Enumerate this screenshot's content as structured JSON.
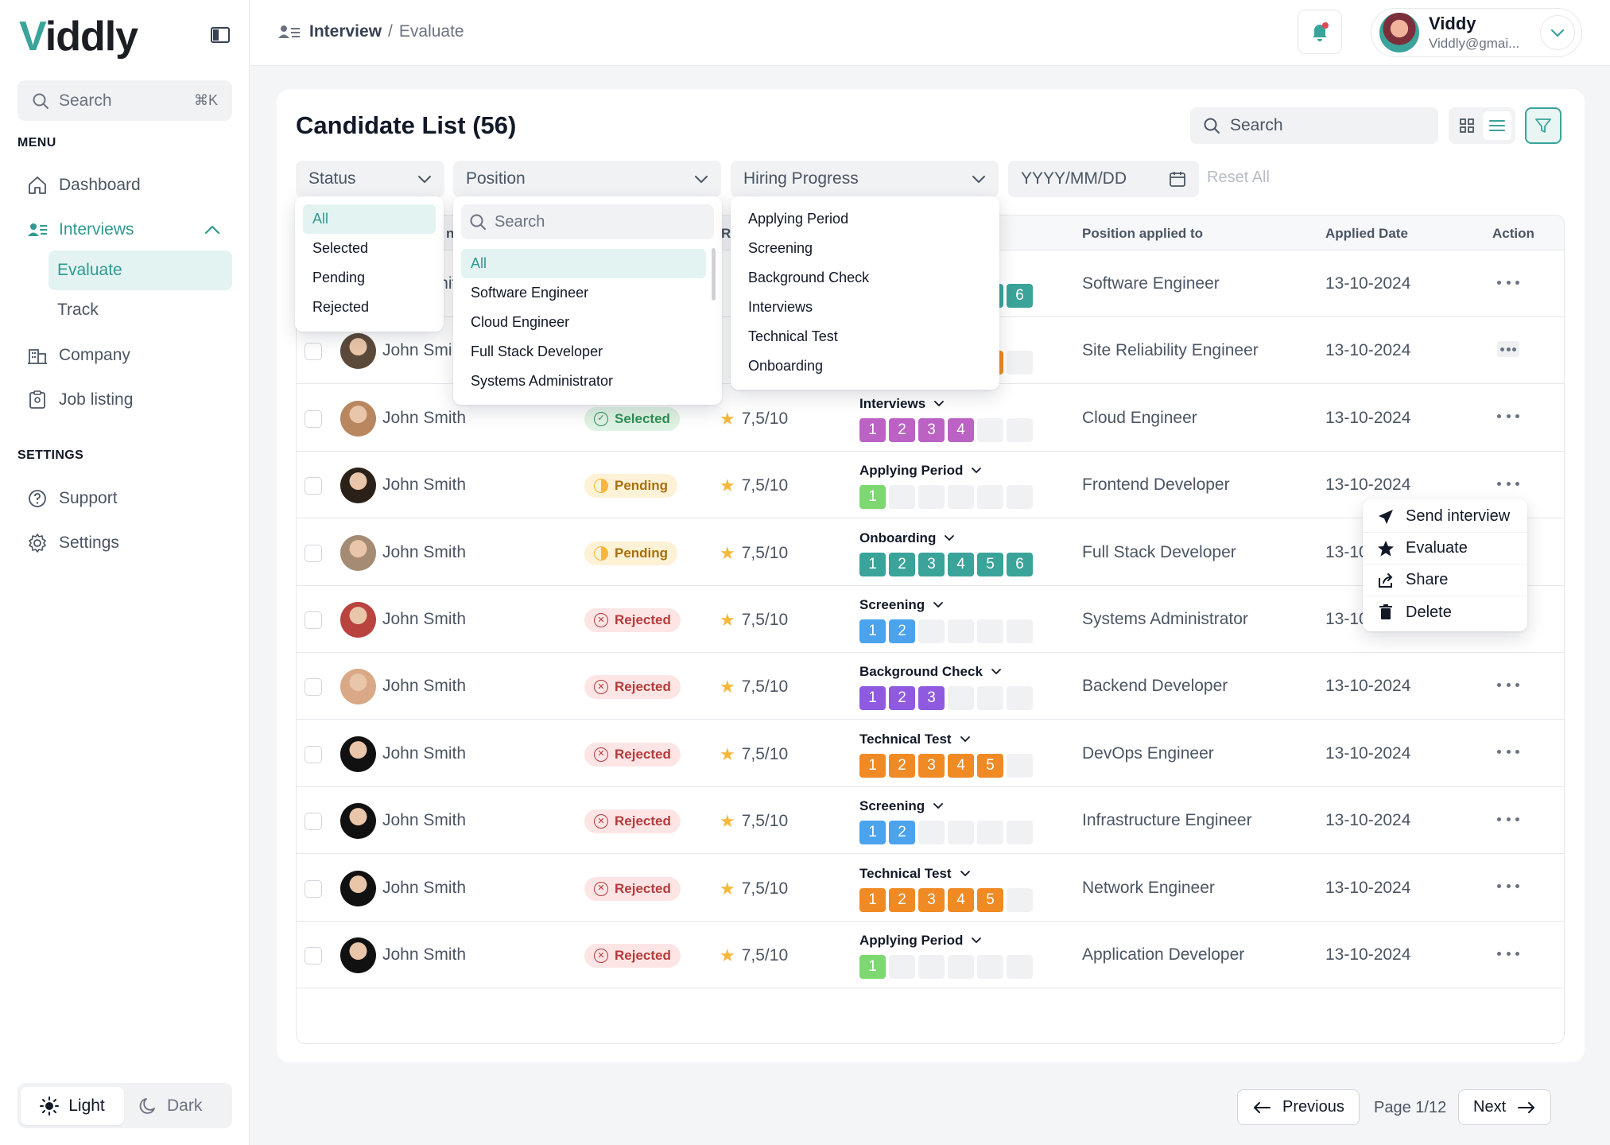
{
  "app": {
    "logo": "iddly",
    "logo_first": "V"
  },
  "sidebar": {
    "search_placeholder": "Search",
    "search_shortcut": "⌘K",
    "menu_heading": "MENU",
    "settings_heading": "SETTINGS",
    "items": {
      "dashboard": "Dashboard",
      "interviews": "Interviews",
      "evaluate": "Evaluate",
      "track": "Track",
      "company": "Company",
      "job_listing": "Job listing",
      "support": "Support",
      "settings": "Settings"
    },
    "theme": {
      "light": "Light",
      "dark": "Dark"
    }
  },
  "header": {
    "breadcrumb": [
      "Interview",
      "Evaluate"
    ],
    "breadcrumb_sep": "/",
    "user": {
      "name": "Viddy",
      "email": "Viddly@gmai..."
    }
  },
  "card": {
    "title": "Candidate List (56)",
    "search_placeholder": "Search",
    "filters": {
      "status": "Status",
      "position": "Position",
      "hiring_progress": "Hiring Progress",
      "date_placeholder": "YYYY/MM/DD",
      "reset": "Reset All"
    }
  },
  "table": {
    "columns": {
      "name_partial": "ne",
      "score_partial": "R",
      "position": "Position applied to",
      "date": "Applied Date",
      "action": "Action"
    },
    "rows": [
      {
        "name": "John Smith",
        "status": "",
        "score": "",
        "stage": "",
        "completed": 6,
        "color": "#3aa39a",
        "position": "Software Engineer",
        "date": "13-10-2024",
        "avatar": "#c9a27c"
      },
      {
        "name": "John Smi",
        "status": "",
        "score": "",
        "stage": "",
        "completed": 5,
        "color": "#f08a24",
        "position": "Site Reliability Engineer",
        "date": "13-10-2024",
        "avatar": "#5b4a3a"
      },
      {
        "name": "John Smith",
        "status": "Selected",
        "status_type": "sel",
        "score": "7,5/10",
        "stage": "Interviews",
        "completed": 4,
        "color": "#bb62c4",
        "position": "Cloud Engineer",
        "date": "13-10-2024",
        "avatar": "#b8865f"
      },
      {
        "name": "John Smith",
        "status": "Pending",
        "status_type": "pen",
        "score": "7,5/10",
        "stage": "Applying Period",
        "completed": 1,
        "color": "#7dd872",
        "position": "Frontend Developer",
        "date": "13-10-2024",
        "avatar": "#2b2118"
      },
      {
        "name": "John Smith",
        "status": "Pending",
        "status_type": "pen",
        "score": "7,5/10",
        "stage": "Onboarding",
        "completed": 6,
        "color": "#3aa39a",
        "position": "Full Stack Developer",
        "date": "13-10",
        "avatar": "#a68b74"
      },
      {
        "name": "John Smith",
        "status": "Rejected",
        "status_type": "rej",
        "score": "7,5/10",
        "stage": "Screening",
        "completed": 2,
        "color": "#4aa3ec",
        "position": "Systems Administrator",
        "date": "13-10",
        "avatar": "#b9433e"
      },
      {
        "name": "John Smith",
        "status": "Rejected",
        "status_type": "rej",
        "score": "7,5/10",
        "stage": "Background Check",
        "completed": 3,
        "color": "#8f5ae0",
        "position": "Backend Developer",
        "date": "13-10-2024",
        "avatar": "#d9a987"
      },
      {
        "name": "John Smith",
        "status": "Rejected",
        "status_type": "rej",
        "score": "7,5/10",
        "stage": "Technical Test",
        "completed": 5,
        "color": "#f08a24",
        "position": "DevOps Engineer",
        "date": "13-10-2024",
        "avatar": "#111111"
      },
      {
        "name": "John Smith",
        "status": "Rejected",
        "status_type": "rej",
        "score": "7,5/10",
        "stage": "Screening",
        "completed": 2,
        "color": "#4aa3ec",
        "position": "Infrastructure Engineer",
        "date": "13-10-2024",
        "avatar": "#111111"
      },
      {
        "name": "John Smith",
        "status": "Rejected",
        "status_type": "rej",
        "score": "7,5/10",
        "stage": "Technical Test",
        "completed": 5,
        "color": "#f08a24",
        "position": "Network Engineer",
        "date": "13-10-2024",
        "avatar": "#111111"
      },
      {
        "name": "John Smith",
        "status": "Rejected",
        "status_type": "rej",
        "score": "7,5/10",
        "stage": "Applying Period",
        "completed": 1,
        "color": "#7dd872",
        "position": "Application Developer",
        "date": "13-10-2024",
        "avatar": "#111111"
      }
    ]
  },
  "dropdowns": {
    "status": [
      "All",
      "Selected",
      "Pending",
      "Rejected"
    ],
    "position_search": "Search",
    "position": [
      "All",
      "Software Engineer",
      "Cloud Engineer",
      "Full Stack Developer",
      "Systems Administrator"
    ],
    "hiring": [
      "Applying Period",
      "Screening",
      "Background Check",
      "Interviews",
      "Technical Test",
      "Onboarding"
    ],
    "action_menu": [
      "Send interview",
      "Evaluate",
      "Share",
      "Delete"
    ]
  },
  "pagination": {
    "previous": "Previous",
    "page": "Page 1/12",
    "next": "Next"
  },
  "colors": {
    "accent": "#3aa39a",
    "star": "#f5b83b"
  }
}
